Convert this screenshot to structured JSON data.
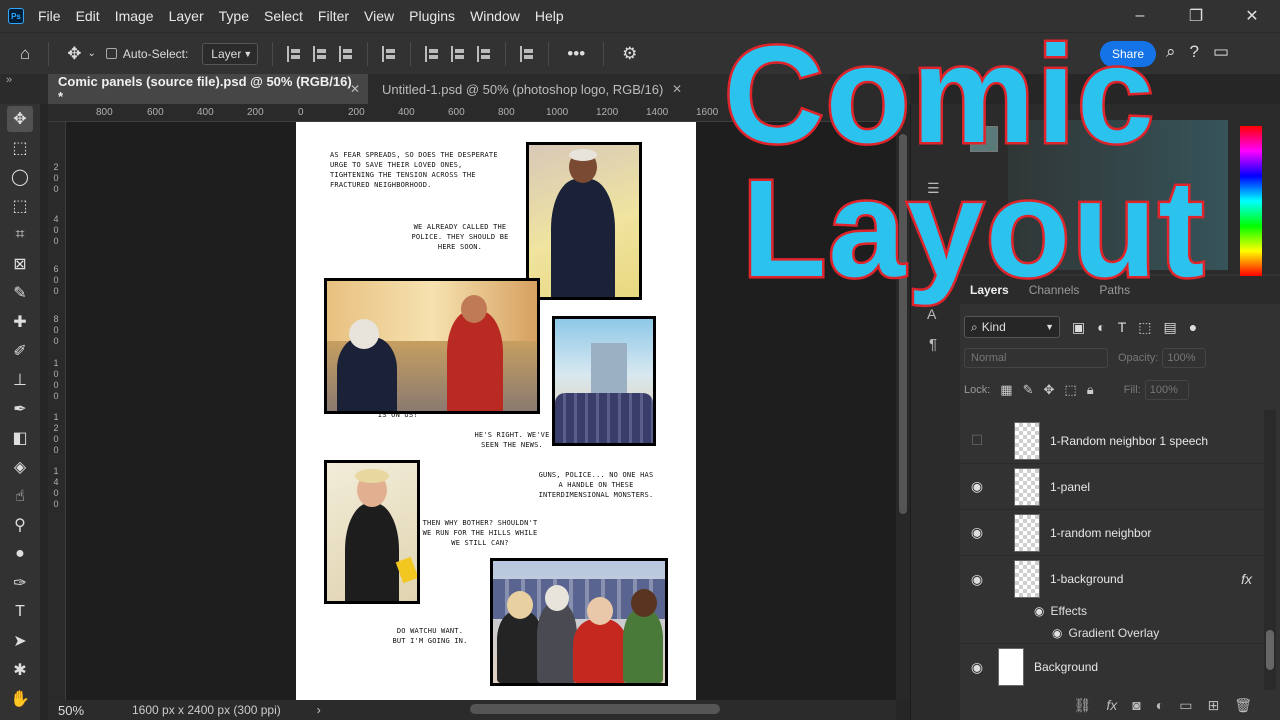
{
  "menu": {
    "logo_text": "Ps",
    "items": [
      "File",
      "Edit",
      "Image",
      "Layer",
      "Type",
      "Select",
      "Filter",
      "View",
      "Plugins",
      "Window",
      "Help"
    ]
  },
  "options": {
    "auto_select_label": "Auto-Select:",
    "layer_select_value": "Layer",
    "share_label": "Share"
  },
  "tabs": [
    {
      "label": "Comic panels (source file).psd @ 50% (RGB/16) *"
    },
    {
      "label": "Untitled-1.psd @ 50% (photoshop logo, RGB/16)"
    }
  ],
  "ruler": {
    "top_labels": [
      "800",
      "600",
      "400",
      "200",
      "0",
      "200",
      "400",
      "600",
      "800",
      "1000",
      "1200",
      "1400",
      "1600"
    ],
    "left_labels": [
      "200",
      "400",
      "600",
      "800",
      "1000",
      "1200",
      "1400"
    ]
  },
  "comic": {
    "captions": [
      "As fear spreads, so does the desperate urge to save their loved ones, tightening the tension across the fractured neighborhood.",
      "We already called the police. They should be here soon.",
      "Police gonna do jack squat! This...this is on us!\"",
      "He's right. We've seen the news.",
      "Guns, police... no one has a handle on these interdimensional monsters.",
      "Then why bother? Shouldn't we run for the hills while we still can?",
      "Do watchu want. But I'm going in."
    ]
  },
  "status": {
    "zoom": "50%",
    "doc_size": "1600 px x 2400 px (300 ppi)",
    "arrow": "›"
  },
  "panels": {
    "tabs": [
      "Layers",
      "Channels",
      "Paths"
    ],
    "kind_label": "Kind",
    "blend_mode": "Normal",
    "opacity_label": "Opacity:",
    "opacity_value": "100%",
    "lock_label": "Lock:",
    "fill_label": "Fill:",
    "fill_value": "100%"
  },
  "layers": [
    {
      "name": "1-Random neighbor 1 speech",
      "visible": false
    },
    {
      "name": "1-panel",
      "visible": true
    },
    {
      "name": "1-random neighbor",
      "visible": true
    },
    {
      "name": "1-background",
      "visible": true,
      "fx": "fx"
    },
    {
      "name": "Background",
      "visible": true
    }
  ],
  "effects": {
    "group_label": "Effects",
    "items": [
      "Gradient Overlay"
    ]
  },
  "overlay": {
    "line1": "Comic",
    "line2": "Layout"
  },
  "colors": {
    "overlay_fill": "#2bc3ee",
    "overlay_stroke": "#e0242b",
    "share_blue": "#1473e6"
  }
}
